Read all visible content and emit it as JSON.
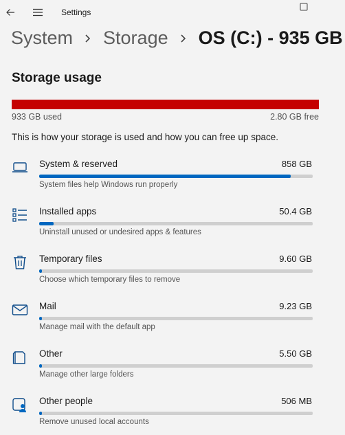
{
  "window": {
    "title": "Settings"
  },
  "breadcrumb": [
    "System",
    "Storage",
    "OS (C:) - 935 GB"
  ],
  "storage": {
    "heading": "Storage usage",
    "used": "933 GB used",
    "free": "2.80 GB free",
    "used_fraction": 0.997,
    "bar_color": "#c50000",
    "description": "This is how your storage is used and how you can free up space."
  },
  "accent_color": "#0067c0",
  "categories": [
    {
      "name": "System & reserved",
      "size": "858 GB",
      "subtitle": "System files help Windows run properly",
      "fraction": 0.92,
      "icon": "laptop-icon"
    },
    {
      "name": "Installed apps",
      "size": "50.4 GB",
      "subtitle": "Uninstall unused or undesired apps & features",
      "fraction": 0.054,
      "icon": "apps-list-icon"
    },
    {
      "name": "Temporary files",
      "size": "9.60 GB",
      "subtitle": "Choose which temporary files to remove",
      "fraction": 0.011,
      "icon": "trash-icon"
    },
    {
      "name": "Mail",
      "size": "9.23 GB",
      "subtitle": "Manage mail with the default app",
      "fraction": 0.01,
      "icon": "mail-icon"
    },
    {
      "name": "Other",
      "size": "5.50 GB",
      "subtitle": "Manage other large folders",
      "fraction": 0.006,
      "icon": "folder-icon"
    },
    {
      "name": "Other people",
      "size": "506 MB",
      "subtitle": "Remove unused local accounts",
      "fraction": 0.002,
      "icon": "people-icon"
    }
  ]
}
